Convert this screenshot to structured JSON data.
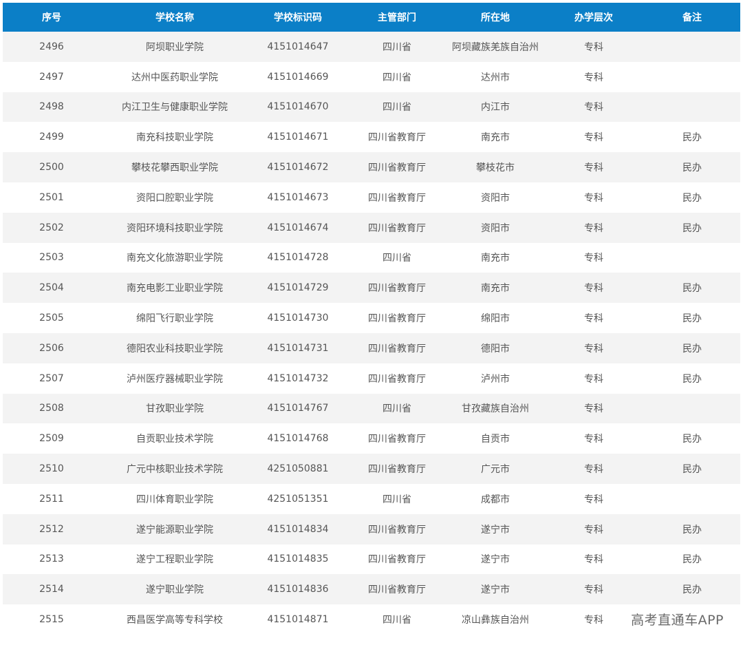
{
  "table": {
    "headers": [
      "序号",
      "学校名称",
      "学校标识码",
      "主管部门",
      "所在地",
      "办学层次",
      "备注"
    ],
    "rows": [
      [
        "2496",
        "阿坝职业学院",
        "4151014647",
        "四川省",
        "阿坝藏族羌族自治州",
        "专科",
        ""
      ],
      [
        "2497",
        "达州中医药职业学院",
        "4151014669",
        "四川省",
        "达州市",
        "专科",
        ""
      ],
      [
        "2498",
        "内江卫生与健康职业学院",
        "4151014670",
        "四川省",
        "内江市",
        "专科",
        ""
      ],
      [
        "2499",
        "南充科技职业学院",
        "4151014671",
        "四川省教育厅",
        "南充市",
        "专科",
        "民办"
      ],
      [
        "2500",
        "攀枝花攀西职业学院",
        "4151014672",
        "四川省教育厅",
        "攀枝花市",
        "专科",
        "民办"
      ],
      [
        "2501",
        "资阳口腔职业学院",
        "4151014673",
        "四川省教育厅",
        "资阳市",
        "专科",
        "民办"
      ],
      [
        "2502",
        "资阳环境科技职业学院",
        "4151014674",
        "四川省教育厅",
        "资阳市",
        "专科",
        "民办"
      ],
      [
        "2503",
        "南充文化旅游职业学院",
        "4151014728",
        "四川省",
        "南充市",
        "专科",
        ""
      ],
      [
        "2504",
        "南充电影工业职业学院",
        "4151014729",
        "四川省教育厅",
        "南充市",
        "专科",
        "民办"
      ],
      [
        "2505",
        "绵阳飞行职业学院",
        "4151014730",
        "四川省教育厅",
        "绵阳市",
        "专科",
        "民办"
      ],
      [
        "2506",
        "德阳农业科技职业学院",
        "4151014731",
        "四川省教育厅",
        "德阳市",
        "专科",
        "民办"
      ],
      [
        "2507",
        "泸州医疗器械职业学院",
        "4151014732",
        "四川省教育厅",
        "泸州市",
        "专科",
        "民办"
      ],
      [
        "2508",
        "甘孜职业学院",
        "4151014767",
        "四川省",
        "甘孜藏族自治州",
        "专科",
        ""
      ],
      [
        "2509",
        "自贡职业技术学院",
        "4151014768",
        "四川省教育厅",
        "自贡市",
        "专科",
        "民办"
      ],
      [
        "2510",
        "广元中核职业技术学院",
        "4251050881",
        "四川省教育厅",
        "广元市",
        "专科",
        "民办"
      ],
      [
        "2511",
        "四川体育职业学院",
        "4251051351",
        "四川省",
        "成都市",
        "专科",
        ""
      ],
      [
        "2512",
        "遂宁能源职业学院",
        "4151014834",
        "四川省教育厅",
        "遂宁市",
        "专科",
        "民办"
      ],
      [
        "2513",
        "遂宁工程职业学院",
        "4151014835",
        "四川省教育厅",
        "遂宁市",
        "专科",
        "民办"
      ],
      [
        "2514",
        "遂宁职业学院",
        "4151014836",
        "四川省教育厅",
        "遂宁市",
        "专科",
        "民办"
      ],
      [
        "2515",
        "西昌医学高等专科学校",
        "4151014871",
        "四川省",
        "凉山彝族自治州",
        "专科",
        ""
      ]
    ]
  },
  "watermark": "高考直通车APP"
}
